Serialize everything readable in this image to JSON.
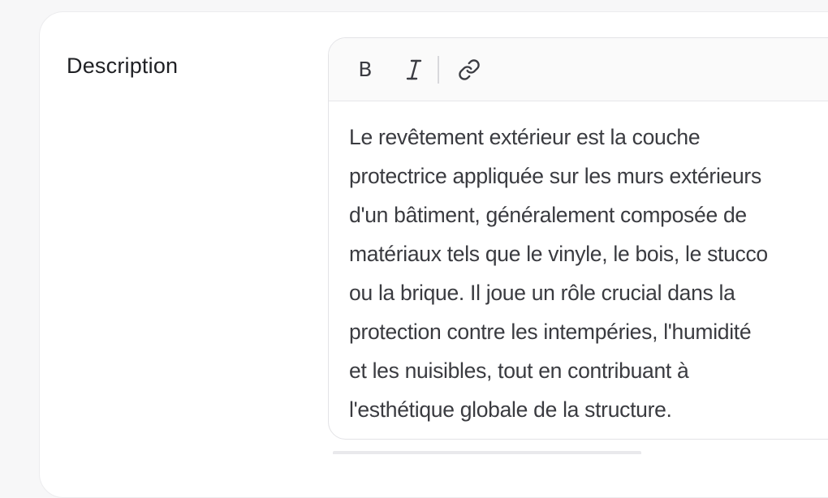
{
  "form": {
    "description_label": "Description"
  },
  "editor": {
    "toolbar": {
      "bold_icon": "bold-icon",
      "italic_icon": "italic-icon",
      "link_icon": "link-icon"
    },
    "content": "Le revêtement extérieur est la couche\nprotectrice appliquée sur les murs extérieurs\nd'un bâtiment, généralement composée de\nmatériaux tels que le vinyle, le bois, le stucco\nou la brique. Il joue un rôle crucial dans la\nprotection contre les intempéries, l'humidité\net les nuisibles, tout en contribuant à\nl'esthétique globale de la structure."
  },
  "colors": {
    "text": "#3a3b40",
    "label": "#1f2024",
    "border": "#e3e3e6",
    "toolbar_bg": "#fafafa"
  }
}
